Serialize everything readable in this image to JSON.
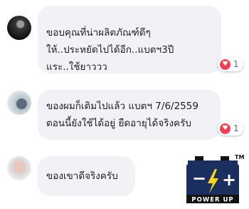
{
  "comments": [
    {
      "lines": [
        "ขอบคุณที่น่าผลิตภัณฑ์ดีๆ",
        "ให้..ประหยัดไปได้อีก..แบตฯ3ปี",
        "แระ..ใช้ยาววว"
      ],
      "reaction": {
        "icon": "heart-icon",
        "count": "1"
      }
    },
    {
      "lines": [
        "ของผมก็เติมไปแล้ว แบตฯ 7/6/2559",
        "ตอนนี้ยังใช้ได้อยู่ ยืดอายุได้จริงครับ"
      ],
      "reaction": {
        "icon": "heart-icon",
        "count": "1"
      }
    },
    {
      "lines": [
        "ของเขาดีจริงครับ"
      ]
    }
  ],
  "logo": {
    "minus": "−",
    "plus": "+",
    "tagline": "POWER UP",
    "trademark": "TM",
    "colors": {
      "body": "#1a2f5e",
      "lightning": "#f5d21c",
      "terminal": "#111111"
    }
  },
  "colors": {
    "bubble": "#f0f2f5",
    "heart": "#f33e58"
  }
}
